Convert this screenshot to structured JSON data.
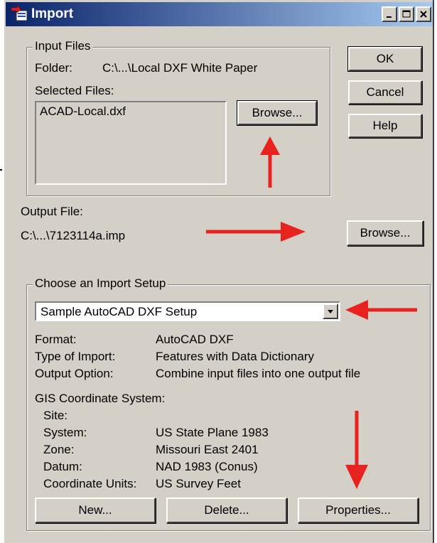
{
  "window": {
    "title": "Import",
    "icons": [
      "import-app-icon",
      "minimize-icon",
      "maximize-icon",
      "close-icon"
    ]
  },
  "input_files": {
    "group_label": "Input Files",
    "folder_label": "Folder:",
    "folder_value": "C:\\...\\Local DXF White Paper",
    "selected_label": "Selected Files:",
    "files": [
      "ACAD-Local.dxf"
    ],
    "browse_label": "Browse..."
  },
  "output_file": {
    "label": "Output File:",
    "value": "C:\\...\\7123114a.imp",
    "browse_label": "Browse..."
  },
  "actions": {
    "ok_label": "OK",
    "cancel_label": "Cancel",
    "help_label": "Help"
  },
  "import_setup": {
    "group_label": "Choose an Import Setup",
    "selected": "Sample AutoCAD DXF Setup",
    "format_label": "Format:",
    "format_value": "AutoCAD DXF",
    "type_label": "Type of Import:",
    "type_value": "Features with Data Dictionary",
    "output_option_label": "Output Option:",
    "output_option_value": "Combine input files into one output file",
    "gis_label": "GIS Coordinate System:",
    "site_label": "Site:",
    "system_label": "System:",
    "system_value": "US State Plane 1983",
    "zone_label": "Zone:",
    "zone_value": "Missouri East 2401",
    "datum_label": "Datum:",
    "datum_value": "NAD 1983 (Conus)",
    "units_label": "Coordinate Units:",
    "units_value": "US Survey Feet",
    "new_label": "New...",
    "delete_label": "Delete...",
    "properties_label": "Properties..."
  },
  "colors": {
    "annotation_arrow": "#e8231f",
    "titlebar_start": "#0a246a",
    "titlebar_end": "#a6caf0",
    "dialog_face": "#d4d0c8"
  }
}
